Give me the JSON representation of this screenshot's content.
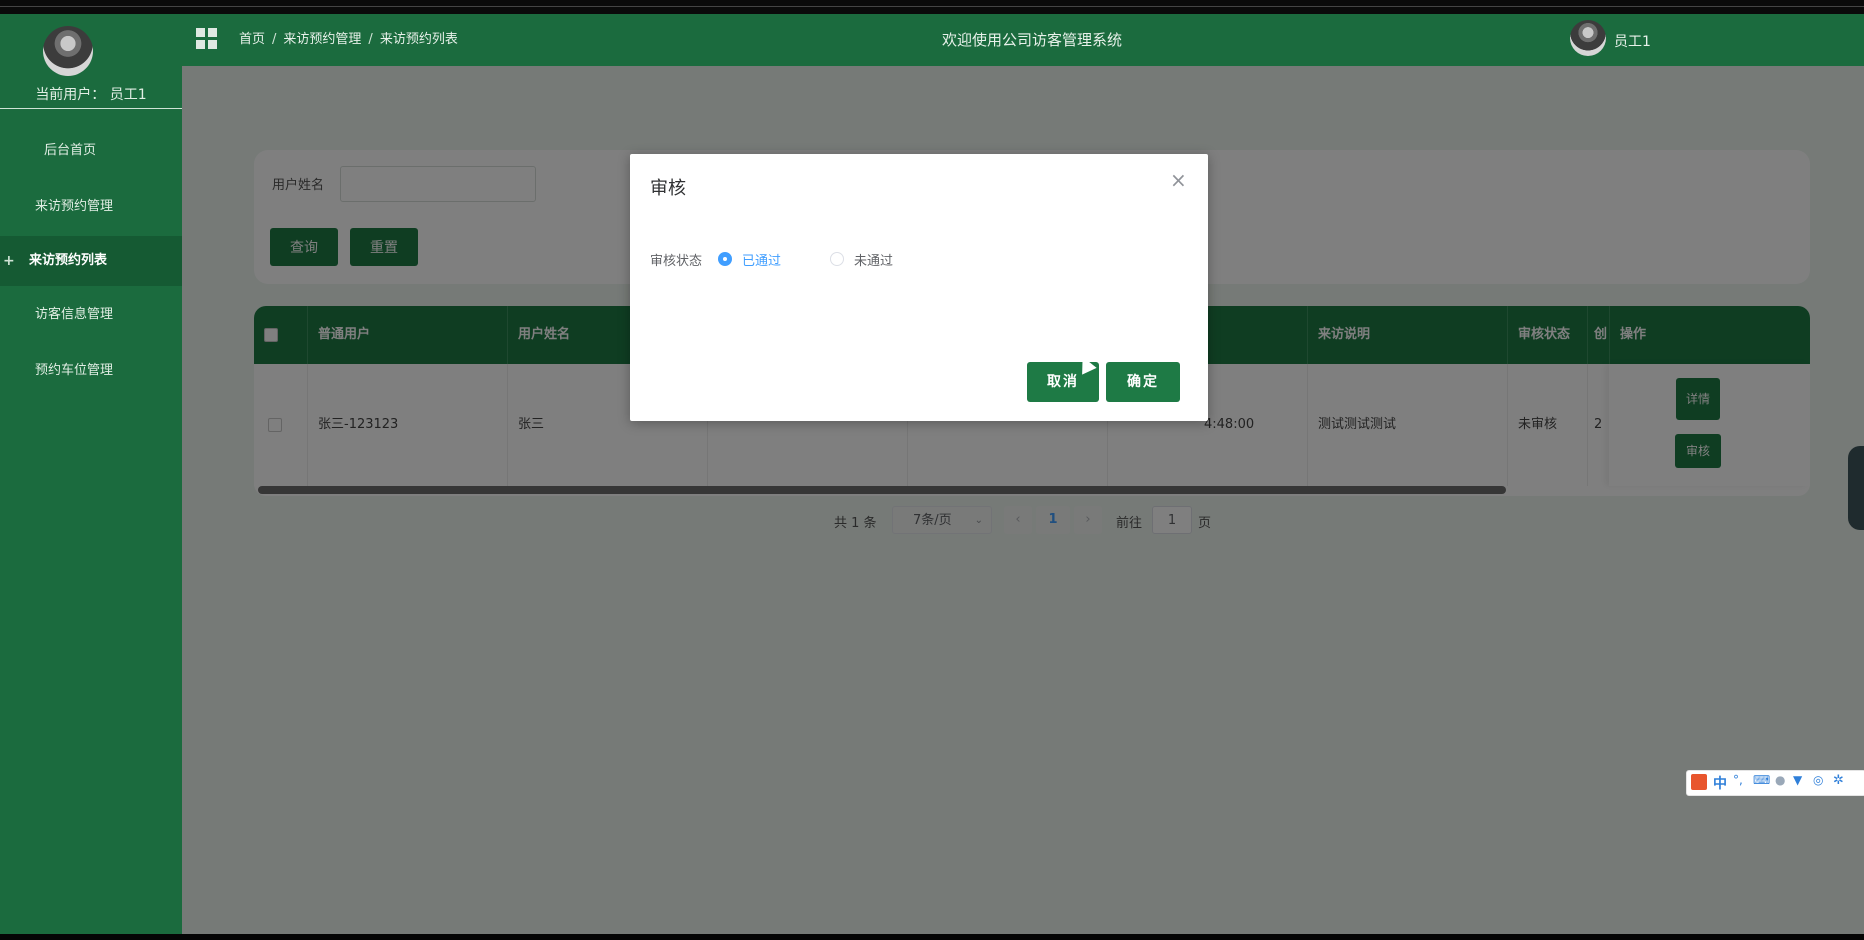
{
  "sidebar": {
    "current_user": "当前用户：  员工1",
    "menu": [
      {
        "label": "后台首页"
      },
      {
        "label": "来访预约管理"
      },
      {
        "label": "来访预约列表",
        "active": true
      },
      {
        "label": "访客信息管理"
      },
      {
        "label": "预约车位管理"
      }
    ],
    "active_marker": "+"
  },
  "header": {
    "breadcrumb": [
      "首页",
      "来访预约管理",
      "来访预约列表"
    ],
    "separator": "/",
    "title": "欢迎使用公司访客管理系统",
    "user_name": "员工1"
  },
  "search": {
    "field_label": "用户姓名",
    "field_value": "",
    "query_label": "查询",
    "reset_label": "重置"
  },
  "table": {
    "columns": [
      "普通用户",
      "用户姓名",
      "",
      "",
      "",
      "来访说明",
      "审核状态",
      "创",
      "操作"
    ],
    "rows": [
      {
        "cells": [
          "张三-123123",
          "张三",
          "",
          "",
          "4:48:00",
          "测试测试测试",
          "未审核",
          "2"
        ],
        "actions": [
          "详情",
          "审核"
        ]
      }
    ]
  },
  "pagination": {
    "total": "共 1 条",
    "page_size": "7条/页",
    "prev": "‹",
    "current_page": "1",
    "next": "›",
    "goto_label": "前往",
    "goto_value": "1",
    "page_suffix": "页"
  },
  "dialog": {
    "title": "审核",
    "close": "×",
    "field_label": "审核状态",
    "options": [
      {
        "label": "已通过",
        "checked": true
      },
      {
        "label": "未通过",
        "checked": false
      }
    ],
    "cancel_label": "取消",
    "confirm_label": "确定"
  },
  "ime_toolbar": {
    "lang": "中",
    "punct": "°,"
  },
  "colors": {
    "primary": "#1e7a45",
    "sidebar": "#1b6b3e",
    "radio_checked": "#409eff"
  }
}
